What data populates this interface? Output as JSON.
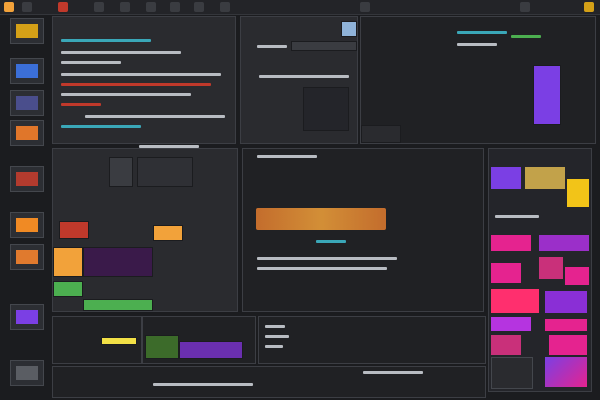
{
  "window": {
    "title": ""
  },
  "topbar": {
    "tools": [
      "app-icon",
      "file-icon",
      "edit-icon",
      "view-icon",
      "layers-icon",
      "brush-icon",
      "crop-icon",
      "grid-icon",
      "color-icon",
      "settings-icon",
      "help-icon",
      "window-icon"
    ]
  },
  "sidebar": {
    "thumbnails": [
      {
        "icon": "thumbnail-icon",
        "color": "#d4a017"
      },
      {
        "icon": "thumbnail-icon",
        "color": "#3b6fd8"
      },
      {
        "icon": "thumbnail-icon",
        "color": "#4a4e8c"
      },
      {
        "icon": "thumbnail-icon",
        "color": "#e0762a"
      },
      {
        "icon": "thumbnail-icon",
        "color": "#b33b2e"
      },
      {
        "icon": "thumbnail-icon",
        "color": "#f08a24"
      },
      {
        "icon": "thumbnail-icon",
        "color": "#e07a2e"
      },
      {
        "icon": "thumbnail-icon",
        "color": "#7b3fe4"
      },
      {
        "icon": "thumbnail-icon",
        "color": "#5a5d63"
      }
    ]
  },
  "panels": {
    "top_left": {
      "title": "",
      "lines": [
        "",
        "",
        "",
        "",
        "",
        "",
        "",
        ""
      ]
    },
    "top_center": {
      "title": "",
      "subtitle": ""
    },
    "center": {
      "headline": "",
      "subheadline": "",
      "caption": ""
    },
    "right": {
      "title": ""
    }
  },
  "colors": {
    "accent_orange": "#f2a23a",
    "accent_magenta": "#e5238f",
    "accent_purple": "#7b3fe4",
    "accent_green": "#4caf50",
    "accent_cyan": "#3aa7b8"
  }
}
